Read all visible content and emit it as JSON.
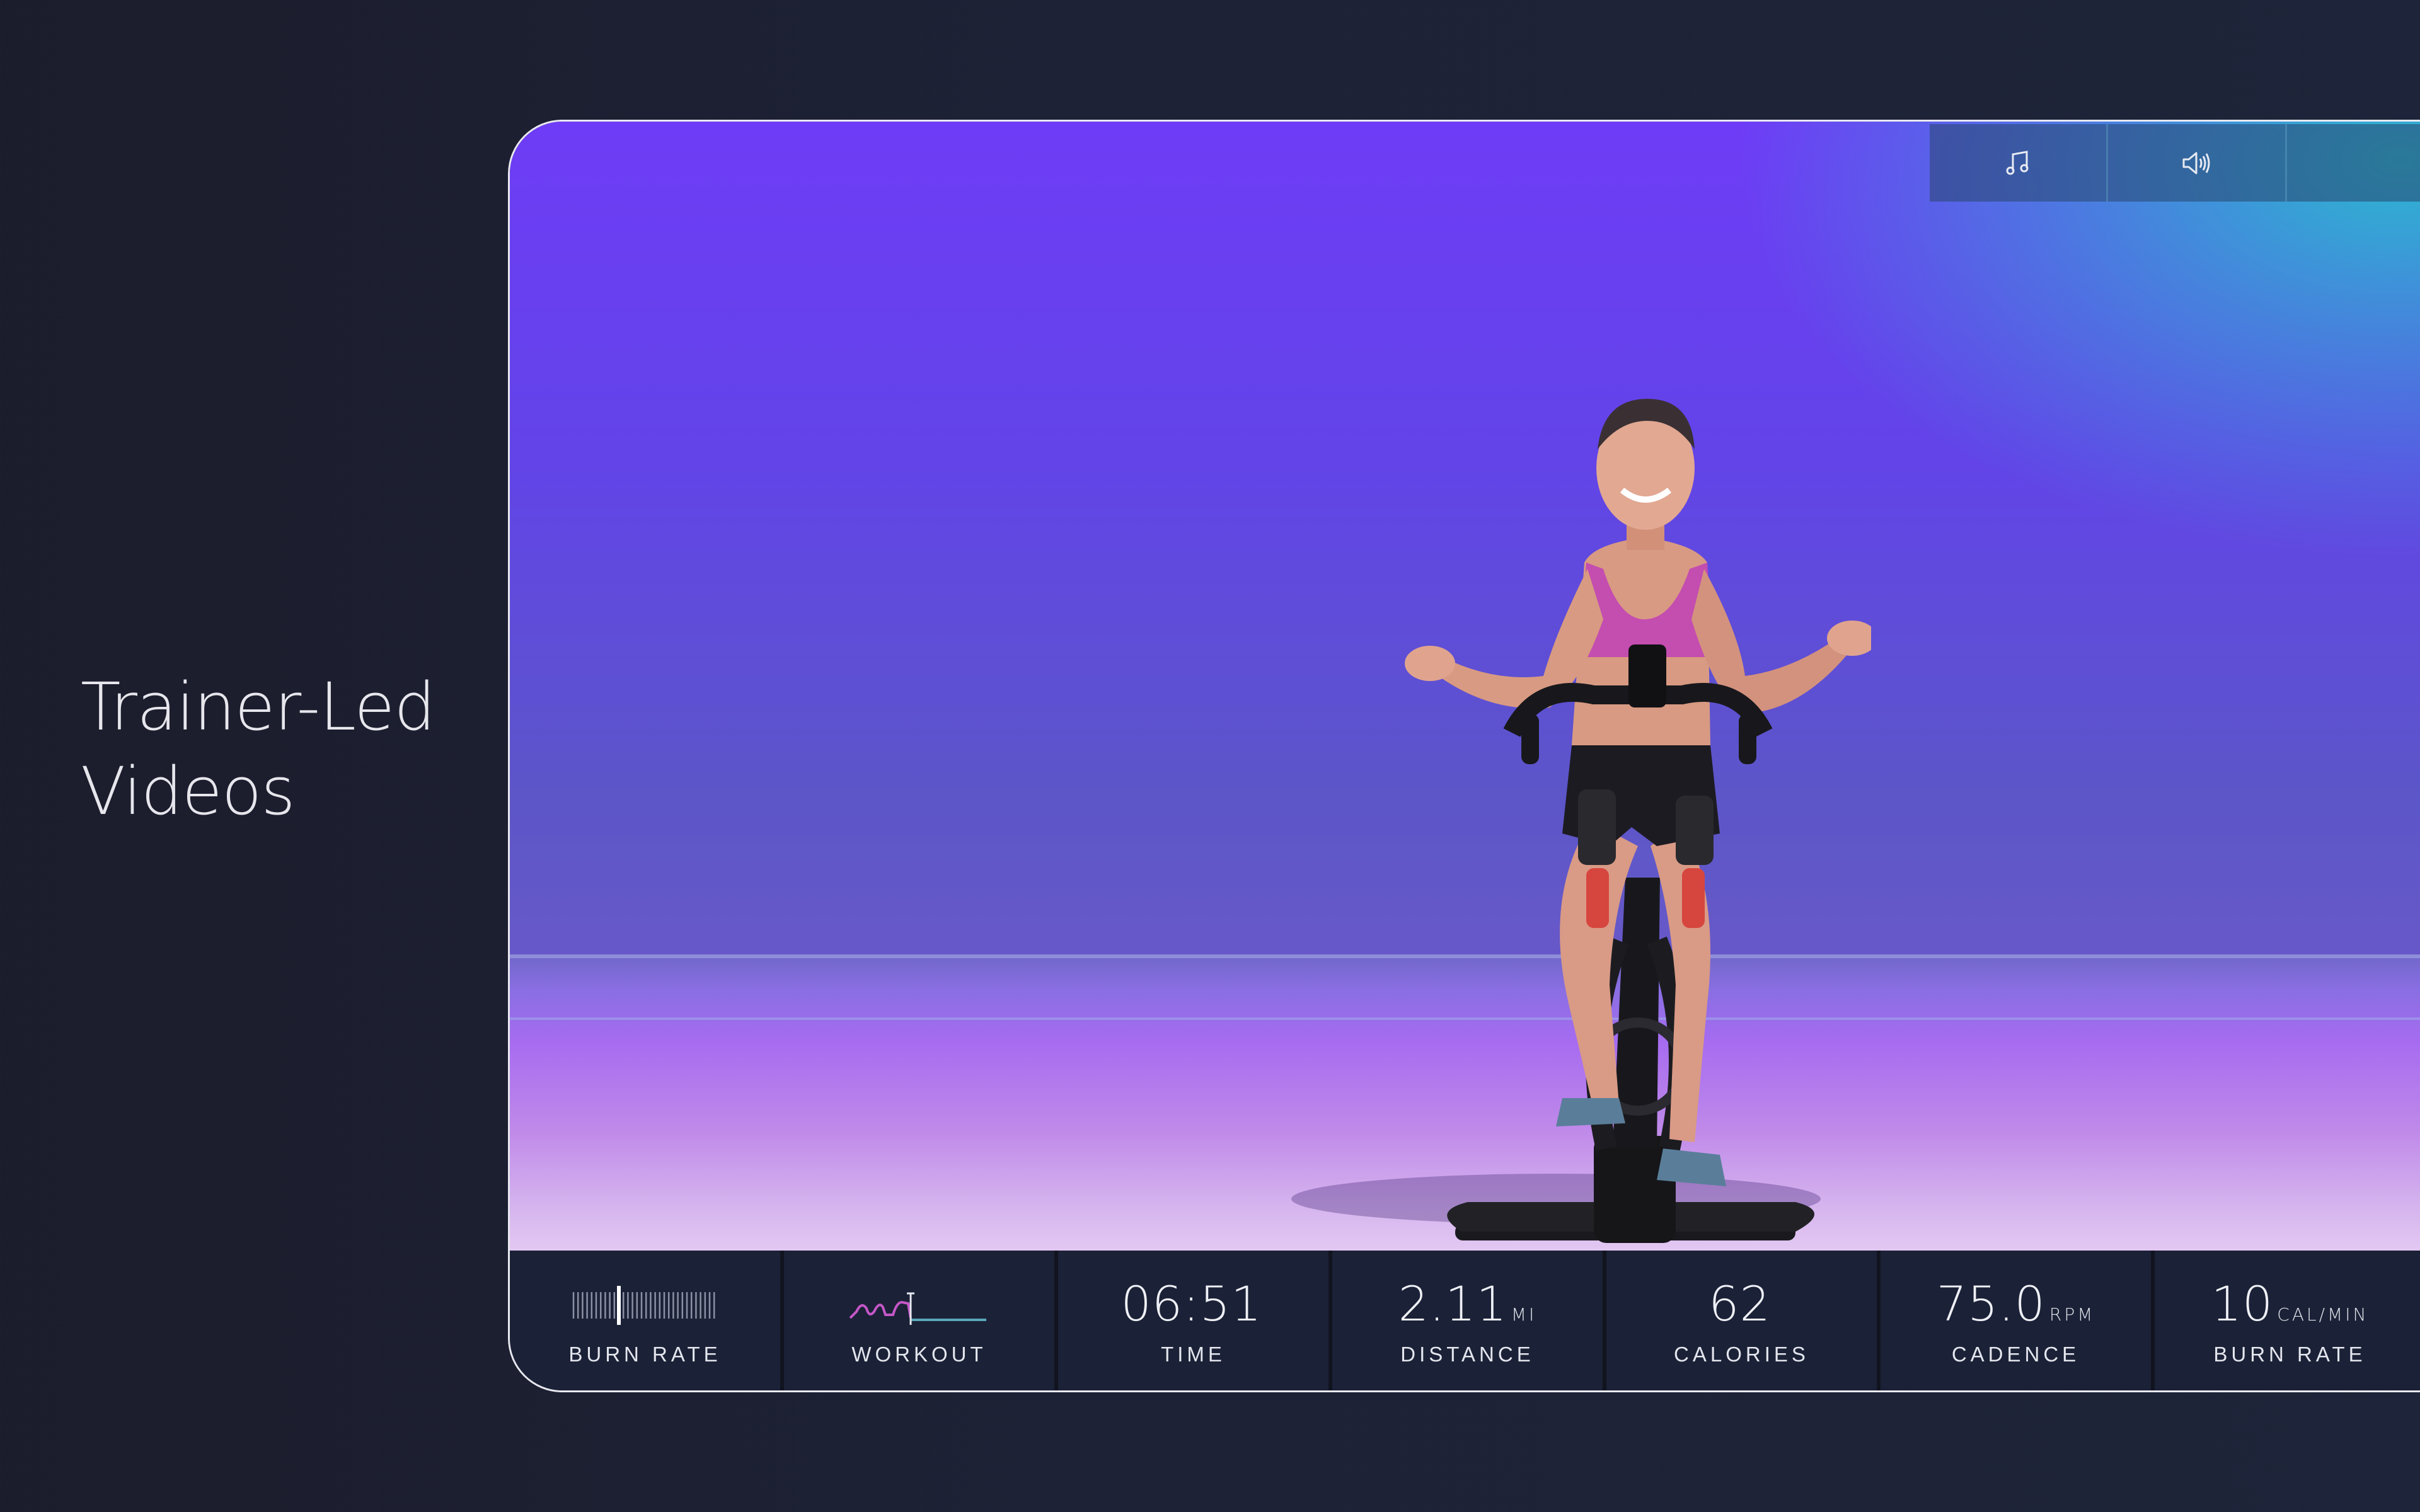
{
  "headline": {
    "line1": "Trainer-Led",
    "line2": "Videos"
  },
  "player": {
    "controls": [
      {
        "name": "music",
        "icon": "music-note-icon"
      },
      {
        "name": "volume",
        "icon": "speaker-volume-icon"
      }
    ]
  },
  "metrics": [
    {
      "id": "burn-rate-gauge",
      "label": "BURN RATE",
      "graphic": "burn-rate-meter",
      "level": 0.33
    },
    {
      "id": "workout-profile",
      "label": "WORKOUT",
      "graphic": "workout-profile-graph"
    },
    {
      "id": "time",
      "value": "06:51",
      "unit": "",
      "label": "TIME"
    },
    {
      "id": "distance",
      "value": "2.11",
      "unit": "MI",
      "label": "DISTANCE"
    },
    {
      "id": "calories",
      "value": "62",
      "unit": "",
      "label": "CALORIES"
    },
    {
      "id": "cadence",
      "value": "75.0",
      "unit": "RPM",
      "label": "CADENCE"
    },
    {
      "id": "burn-rate",
      "value": "10",
      "unit": "CAL/MIN",
      "label": "BURN RATE"
    }
  ],
  "colors": {
    "page_bg": "#1c1f31",
    "panel": "#1b2136",
    "video_purple": "#6e3cf6",
    "video_teal": "#2ebecd",
    "accent_pink": "#c457c8"
  }
}
